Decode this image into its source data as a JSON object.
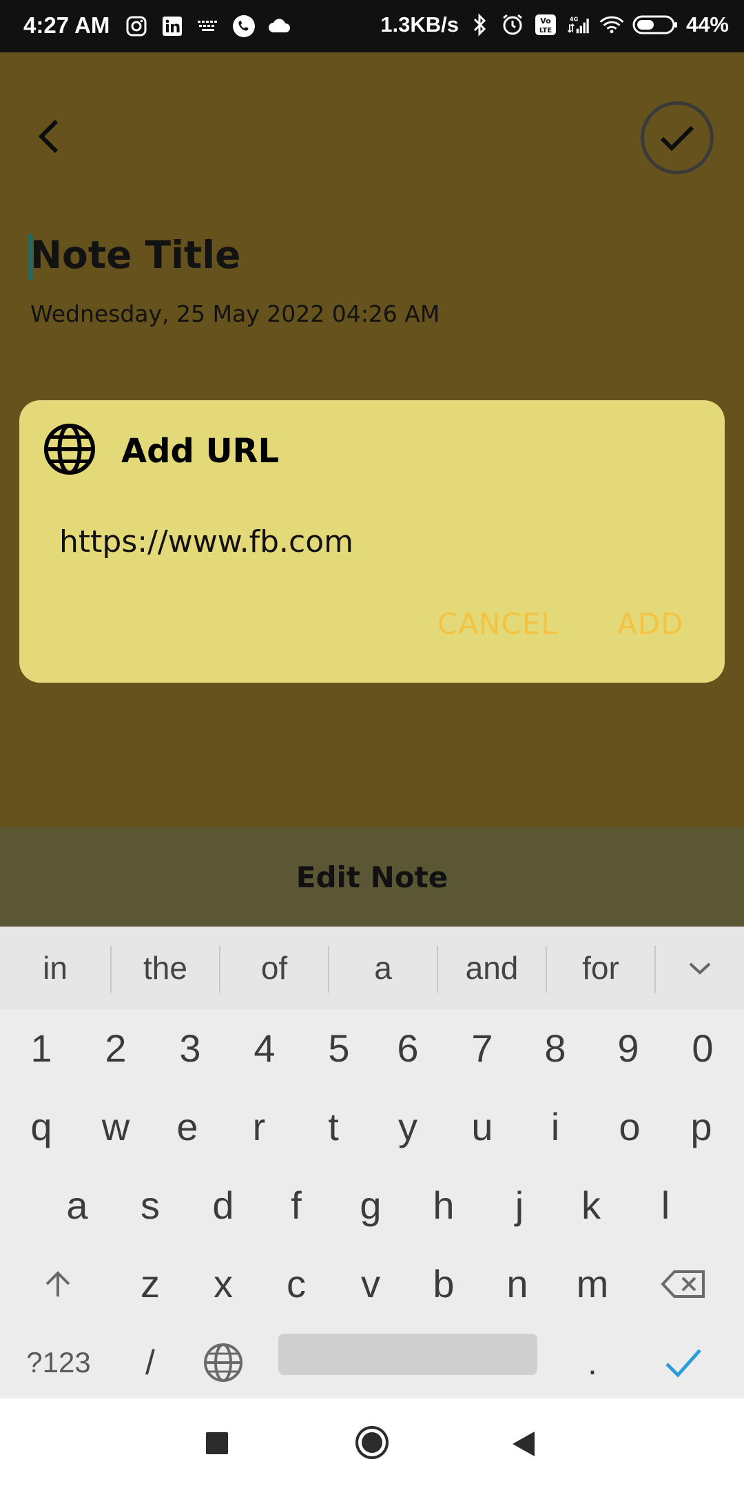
{
  "status_bar": {
    "time": "4:27 AM",
    "net_speed": "1.3KB/s",
    "battery": "44%",
    "icons": [
      "instagram-icon",
      "linkedin-icon",
      "keyboard-icon",
      "phone-icon",
      "cloud-icon",
      "bluetooth-icon",
      "alarm-icon",
      "volte-icon",
      "signal-icon",
      "wifi-icon",
      "battery-icon"
    ]
  },
  "note": {
    "title": "Note Title",
    "date": "Wednesday, 25 May 2022 04:26 AM"
  },
  "dialog": {
    "title": "Add URL",
    "url_value": "https://www.fb.com",
    "cancel_label": "CANCEL",
    "add_label": "ADD"
  },
  "bottom_bar": {
    "label": "Edit Note"
  },
  "keyboard": {
    "suggestions": [
      "in",
      "the",
      "of",
      "a",
      "and",
      "for"
    ],
    "row_numbers": [
      "1",
      "2",
      "3",
      "4",
      "5",
      "6",
      "7",
      "8",
      "9",
      "0"
    ],
    "row_1": [
      "q",
      "w",
      "e",
      "r",
      "t",
      "y",
      "u",
      "i",
      "o",
      "p"
    ],
    "row_2": [
      "a",
      "s",
      "d",
      "f",
      "g",
      "h",
      "j",
      "k",
      "l"
    ],
    "row_3": [
      "z",
      "x",
      "c",
      "v",
      "b",
      "n",
      "m"
    ],
    "symbols_label": "?123",
    "slash": "/",
    "period": "."
  },
  "colors": {
    "app_bg": "#66521d",
    "dialog_bg": "#e4d979",
    "dialog_button": "#f5c242",
    "edit_bar": "#5b5734",
    "accent_check": "#2d9cdb"
  }
}
